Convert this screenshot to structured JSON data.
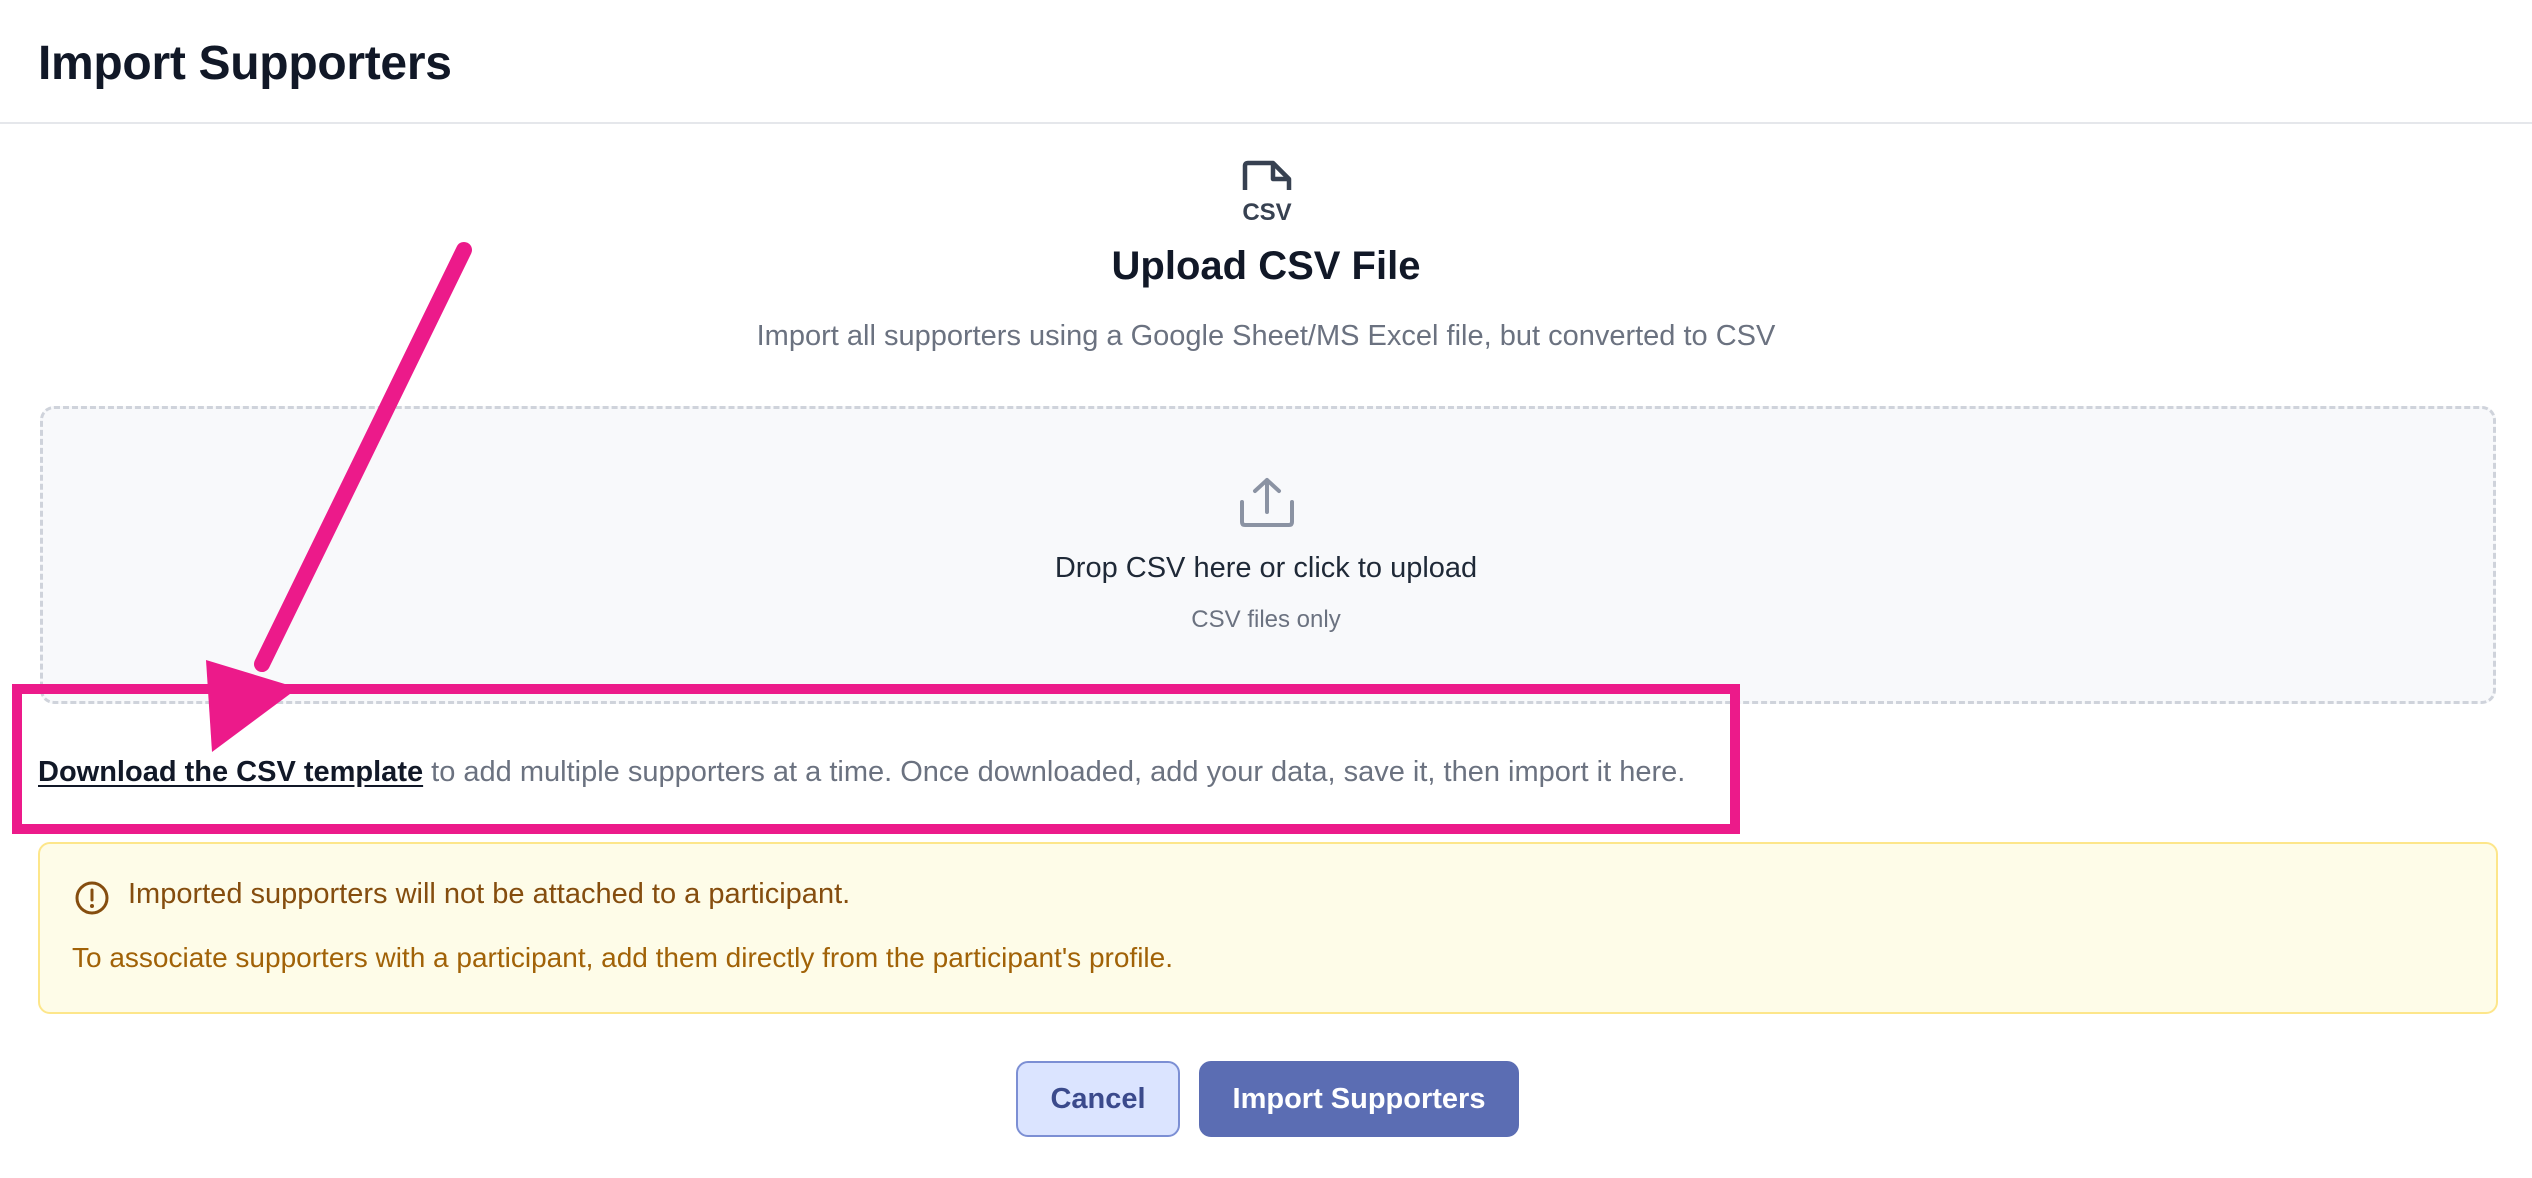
{
  "header": {
    "title": "Import Supporters"
  },
  "upload": {
    "icon": "csv-file-icon",
    "title": "Upload CSV File",
    "subtitle": "Import all supporters using a Google Sheet/MS Excel file, but converted to CSV"
  },
  "dropzone": {
    "icon": "upload-icon",
    "label": "Drop CSV here or click to upload",
    "hint": "CSV files only"
  },
  "template": {
    "link_label": "Download the CSV template",
    "description": " to add multiple supporters at a time. Once downloaded, add your data, save it, then import it here."
  },
  "alert": {
    "icon": "alert-circle-icon",
    "title": "Imported supporters will not be attached to a participant.",
    "body": "To associate supporters with a participant, add them directly from the participant's profile."
  },
  "actions": {
    "cancel_label": "Cancel",
    "import_label": "Import Supporters"
  },
  "colors": {
    "annotation": "#ec1a8a",
    "primary": "#5b6db3",
    "alert_background": "#fefce8",
    "alert_text": "#854d0e"
  }
}
